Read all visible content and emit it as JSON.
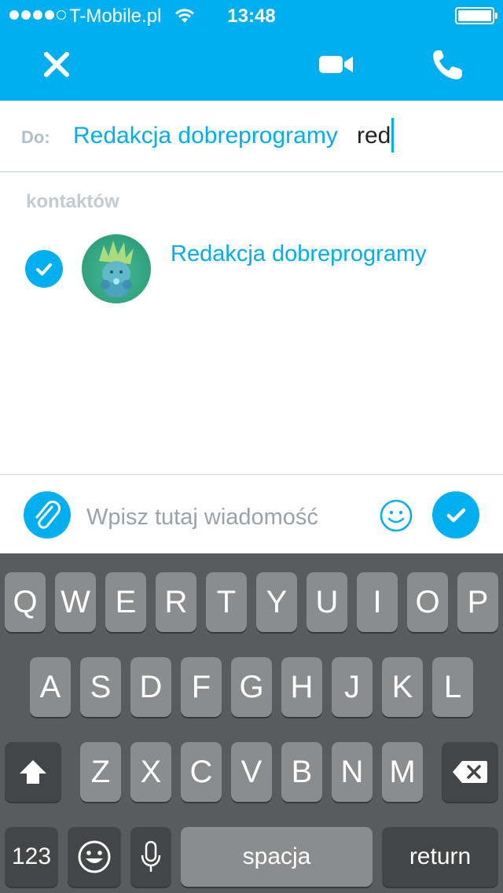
{
  "status_bar": {
    "carrier": "T-Mobile.pl",
    "time": "13:48",
    "signal_dots_filled": 4,
    "signal_dots_total": 5,
    "battery_level": 1.0
  },
  "nav": {
    "close_icon": "close-icon",
    "video_icon": "video-camera-icon",
    "call_icon": "phone-icon"
  },
  "to_field": {
    "label": "Do:",
    "selected_contact": "Redakcja dobreprogramy",
    "typed_text": "red"
  },
  "contacts": {
    "section_label": "kontaktów",
    "items": [
      {
        "name": "Redakcja dobreprogramy",
        "selected": true
      }
    ]
  },
  "composer": {
    "placeholder": "Wpisz tutaj wiadomość",
    "attach_icon": "paperclip-icon",
    "emoji_icon": "smiley-icon",
    "send_icon": "checkmark-icon"
  },
  "keyboard": {
    "row1": [
      "Q",
      "W",
      "E",
      "R",
      "T",
      "Y",
      "U",
      "I",
      "O",
      "P"
    ],
    "row2": [
      "A",
      "S",
      "D",
      "F",
      "G",
      "H",
      "J",
      "K",
      "L"
    ],
    "row3": [
      "Z",
      "X",
      "C",
      "V",
      "B",
      "N",
      "M"
    ],
    "numbers_label": "123",
    "space_label": "spacja",
    "return_label": "return"
  },
  "colors": {
    "accent": "#00aff0",
    "keyboard_bg": "#5a5b5c",
    "key_bg": "#8b8c8d",
    "key_dark_bg": "#444546"
  }
}
